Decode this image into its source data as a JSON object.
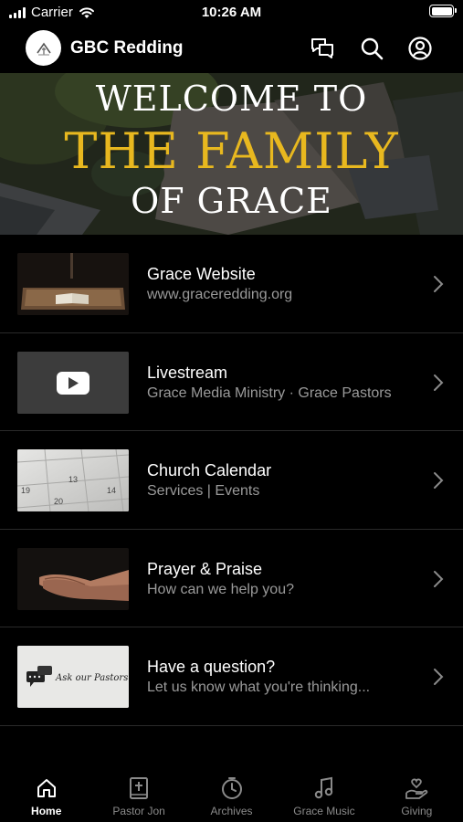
{
  "status_bar": {
    "carrier": "Carrier",
    "time": "10:26 AM"
  },
  "header": {
    "title": "GBC Redding",
    "icons": [
      "chat-icon",
      "search-icon",
      "profile-icon"
    ]
  },
  "banner": {
    "line1": "WELCOME TO",
    "line2": "THE FAMILY",
    "line3": "OF GRACE",
    "accent_color": "#e8b81f"
  },
  "menu": {
    "items": [
      {
        "title": "Grace Website",
        "subtitle": "www.graceredding.org"
      },
      {
        "title": "Livestream",
        "subtitle": "Grace Media Ministry · Grace Pastors"
      },
      {
        "title": "Church Calendar",
        "subtitle": "Services | Events"
      },
      {
        "title": "Prayer & Praise",
        "subtitle": "How can we help you?"
      },
      {
        "title": "Have a question?",
        "subtitle": "Let us know what you're thinking..."
      }
    ],
    "thumbs": {
      "calendar_numbers": [
        "13",
        "14",
        "19",
        "20"
      ],
      "pastors_text": "Ask our Pastors..."
    }
  },
  "tabs": [
    {
      "label": "Home",
      "icon": "home-icon",
      "active": true
    },
    {
      "label": "Pastor Jon",
      "icon": "bible-icon",
      "active": false
    },
    {
      "label": "Archives",
      "icon": "clock-icon",
      "active": false
    },
    {
      "label": "Grace Music",
      "icon": "music-icon",
      "active": false
    },
    {
      "label": "Giving",
      "icon": "giving-icon",
      "active": false
    }
  ]
}
